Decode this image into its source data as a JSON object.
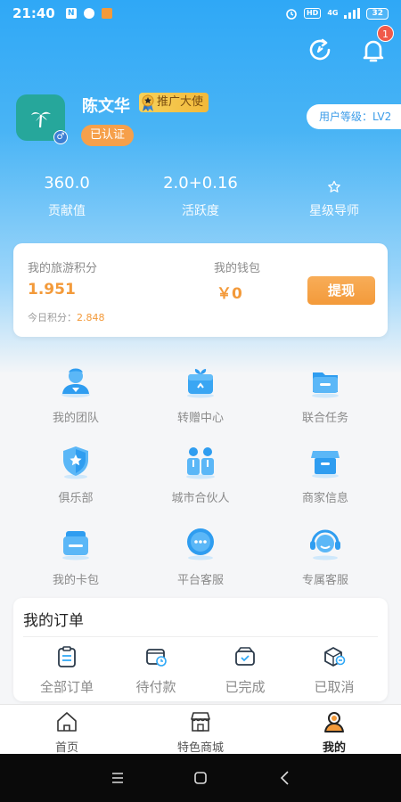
{
  "status_bar": {
    "time": "21:40",
    "hd_label": "HD",
    "net_label": "4G",
    "battery": "32"
  },
  "header": {
    "notification_count": "1"
  },
  "profile": {
    "name": "陈文华",
    "ambassador_badge": "推广大使",
    "verified_label": "已认证",
    "level_label": "用户等级：LV2"
  },
  "stats": [
    {
      "value": "360.0",
      "label": "贡献值"
    },
    {
      "value": "2.0+0.16",
      "label": "活跃度"
    },
    {
      "value": "",
      "label": "星级导师"
    }
  ],
  "wallet": {
    "points_label": "我的旅游积分",
    "points_value": "1.951",
    "today_label": "今日积分：",
    "today_value": "2.848",
    "wallet_label": "我的钱包",
    "wallet_value": "￥0",
    "withdraw_label": "提现"
  },
  "menu": [
    {
      "label": "我的团队",
      "icon": "team-icon"
    },
    {
      "label": "转赠中心",
      "icon": "gift-icon"
    },
    {
      "label": "联合任务",
      "icon": "folder-icon"
    },
    {
      "label": "俱乐部",
      "icon": "shield-star-icon"
    },
    {
      "label": "城市合伙人",
      "icon": "partners-icon"
    },
    {
      "label": "商家信息",
      "icon": "store-icon"
    },
    {
      "label": "我的卡包",
      "icon": "card-icon"
    },
    {
      "label": "平台客服",
      "icon": "chat-icon"
    },
    {
      "label": "专属客服",
      "icon": "headset-icon"
    }
  ],
  "orders": {
    "title": "我的订单",
    "items": [
      {
        "label": "全部订单",
        "icon": "clipboard-icon"
      },
      {
        "label": "待付款",
        "icon": "wallet-clock-icon"
      },
      {
        "label": "已完成",
        "icon": "box-check-icon"
      },
      {
        "label": "已取消",
        "icon": "box-cancel-icon"
      }
    ]
  },
  "tabs": [
    {
      "label": "首页",
      "icon": "home-icon"
    },
    {
      "label": "特色商城",
      "icon": "shop-icon"
    },
    {
      "label": "我的",
      "icon": "profile-icon"
    }
  ],
  "colors": {
    "primary_blue": "#2fa8f6",
    "accent_orange": "#f39a3a",
    "avatar_teal": "#26a79b"
  }
}
